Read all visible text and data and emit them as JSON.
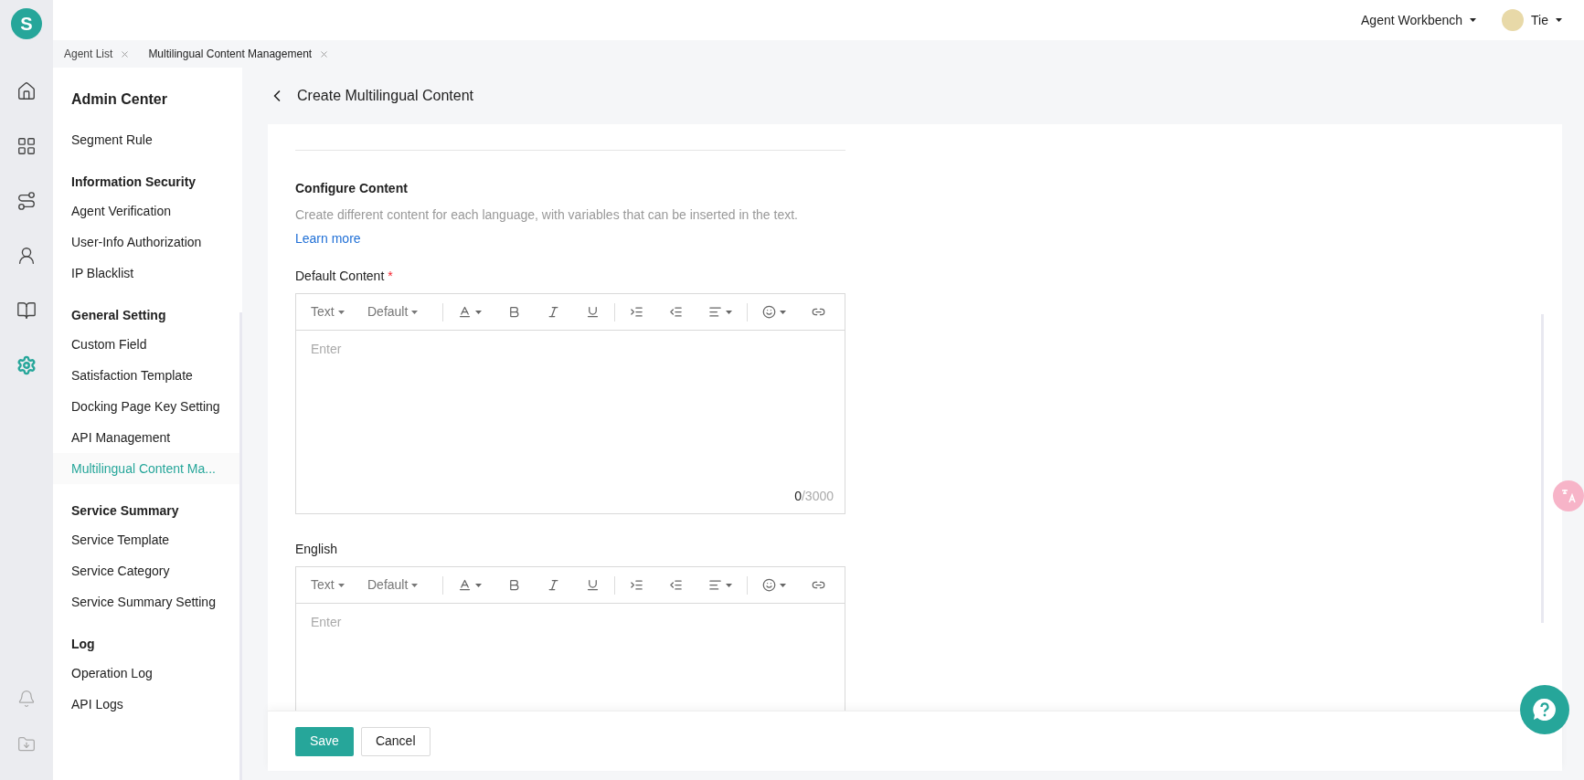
{
  "header": {
    "logo": "S",
    "workspace": "Agent Workbench",
    "user": "Tie"
  },
  "rail": [
    {
      "kind": "home",
      "selected": false
    },
    {
      "kind": "apps",
      "selected": false
    },
    {
      "kind": "route",
      "selected": false
    },
    {
      "kind": "agent",
      "selected": false
    },
    {
      "kind": "book",
      "selected": false
    },
    {
      "kind": "settings",
      "selected": true
    }
  ],
  "rail_bottom": [
    {
      "kind": "bell"
    },
    {
      "kind": "download"
    }
  ],
  "tabs": [
    {
      "label": "Agent List",
      "selected": false
    },
    {
      "label": "Multilingual Content Management",
      "selected": true
    }
  ],
  "sidebar": {
    "title": "Admin Center",
    "groups": [
      {
        "items": [
          {
            "label": "Segment Rule",
            "selected": false
          }
        ]
      },
      {
        "title": "Information Security",
        "items": [
          {
            "label": "Agent Verification",
            "selected": false
          },
          {
            "label": "User-Info Authorization",
            "selected": false
          },
          {
            "label": "IP Blacklist",
            "selected": false
          }
        ]
      },
      {
        "title": "General Setting",
        "items": [
          {
            "label": "Custom Field",
            "selected": false
          },
          {
            "label": "Satisfaction Template",
            "selected": false
          },
          {
            "label": "Docking Page Key Setting",
            "selected": false
          },
          {
            "label": "API Management",
            "selected": false
          },
          {
            "label": "Multilingual Content Ma...",
            "selected": true
          }
        ]
      },
      {
        "title": "Service Summary",
        "items": [
          {
            "label": "Service Template",
            "selected": false
          },
          {
            "label": "Service Category",
            "selected": false
          },
          {
            "label": "Service Summary Setting",
            "selected": false
          }
        ]
      },
      {
        "title": "Log",
        "items": [
          {
            "label": "Operation Log",
            "selected": false
          },
          {
            "label": "API Logs",
            "selected": false
          }
        ]
      }
    ]
  },
  "page": {
    "title": "Create Multilingual Content"
  },
  "section": {
    "title": "Configure Content",
    "description": "Create different content for each language, with variables that can be inserted in the text.",
    "link": "Learn more"
  },
  "editors": [
    {
      "label": "Default Content",
      "required_mark": "*",
      "format": "Text",
      "font": "Default",
      "placeholder": "Enter",
      "count": "0",
      "limit": "/3000"
    },
    {
      "label": "English",
      "format": "Text",
      "font": "Default",
      "placeholder": "Enter"
    }
  ],
  "buttons": [
    {
      "label": "Save",
      "kind": "primary"
    },
    {
      "label": "Cancel",
      "kind": "secondary"
    }
  ]
}
